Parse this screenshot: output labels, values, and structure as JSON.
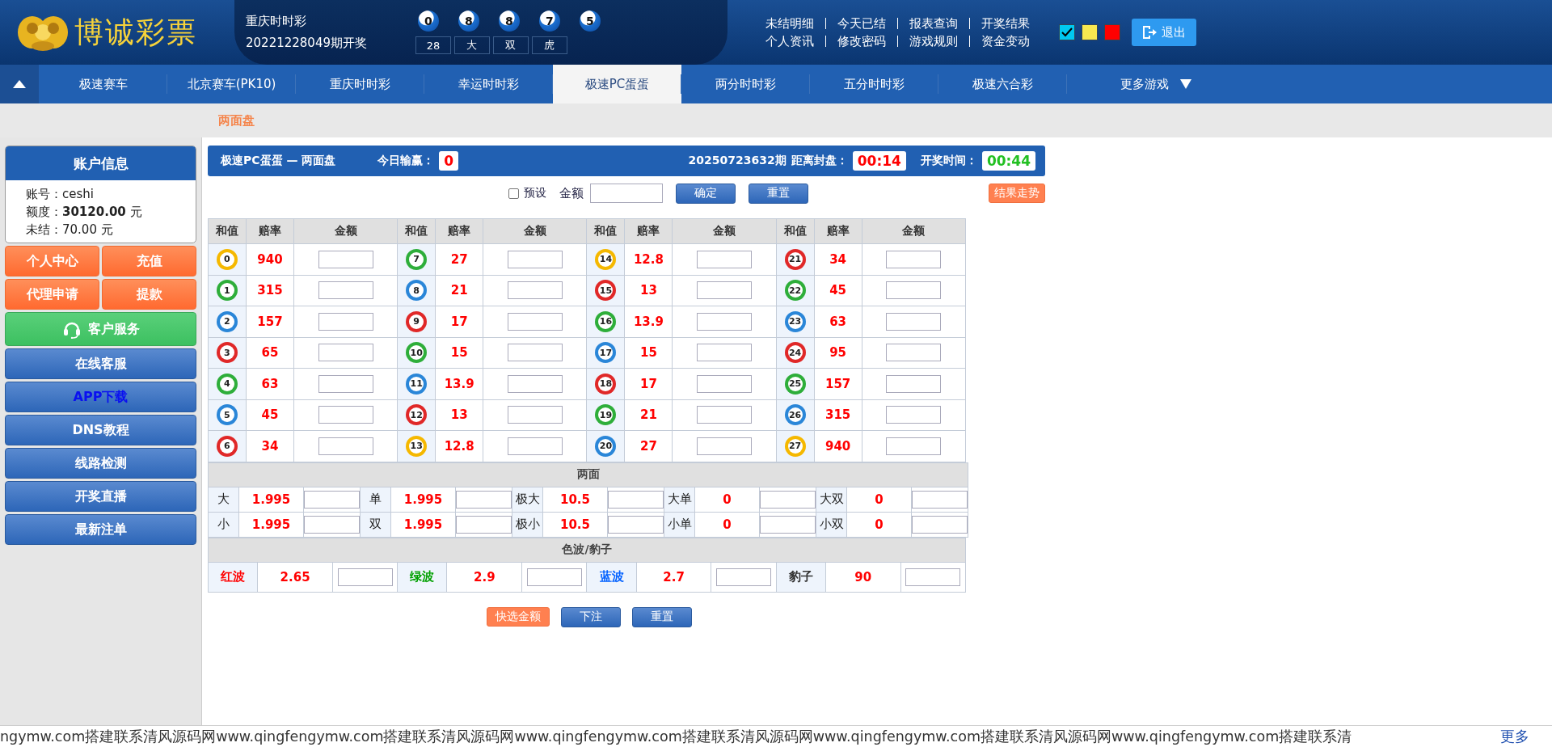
{
  "header": {
    "logo_text": "博诚彩票",
    "lottery": {
      "name": "重庆时时彩",
      "draw": "20221228049期开奖",
      "balls": [
        "0",
        "8",
        "8",
        "7",
        "5"
      ],
      "tags": [
        "28",
        "大",
        "双",
        "虎"
      ]
    },
    "link_rows": [
      [
        "未结明细",
        "今天已结",
        "报表查询",
        "开奖结果"
      ],
      [
        "个人资讯",
        "修改密码",
        "游戏规则",
        "资金变动"
      ]
    ],
    "themes": [
      {
        "color": "#00c8f0",
        "selected": true
      },
      {
        "color": "#f8e850",
        "selected": false
      },
      {
        "color": "#ff0000",
        "selected": false
      }
    ],
    "logout": "退出"
  },
  "nav": {
    "tabs": [
      {
        "label": "极速赛车",
        "selected": false
      },
      {
        "label": "北京赛车(PK10)",
        "selected": false
      },
      {
        "label": "重庆时时彩",
        "selected": false
      },
      {
        "label": "幸运时时彩",
        "selected": false
      },
      {
        "label": "极速PC蛋蛋",
        "selected": true
      },
      {
        "label": "两分时时彩",
        "selected": false
      },
      {
        "label": "五分时时彩",
        "selected": false
      },
      {
        "label": "极速六合彩",
        "selected": false
      }
    ],
    "more": "更多游戏"
  },
  "subnav": "两面盘",
  "sidebar": {
    "account_title": "账户信息",
    "fields": [
      {
        "label": "账号：",
        "value": "ceshi",
        "emphasis": false
      },
      {
        "label": "额度：",
        "value": "30120.00",
        "unit": "元",
        "emphasis": true
      },
      {
        "label": "未结：",
        "value": "70.00",
        "unit": "元",
        "emphasis": false
      }
    ],
    "buttons": [
      {
        "label": "个人中心",
        "kind": "orange"
      },
      {
        "label": "充值",
        "kind": "orange"
      },
      {
        "label": "代理申请",
        "kind": "orange"
      },
      {
        "label": "提款",
        "kind": "orange"
      },
      {
        "label": "客户服务",
        "kind": "service"
      },
      {
        "label": "在线客服",
        "kind": "blue"
      },
      {
        "label": "APP下载",
        "kind": "accent"
      },
      {
        "label": "DNS教程",
        "kind": "blue"
      },
      {
        "label": "线路检测",
        "kind": "blue"
      },
      {
        "label": "开奖直播",
        "kind": "blue"
      },
      {
        "label": "最新注单",
        "kind": "blue"
      }
    ]
  },
  "game_bar": {
    "title": "极速PC蛋蛋 — 两面盘",
    "today_label": "今日输赢：",
    "today_value": "0",
    "period": "20250723632期",
    "close_label": "距离封盘：",
    "close_time": "00:14",
    "draw_label": "开奖时间：",
    "draw_time": "00:44"
  },
  "toolbar": {
    "preset": {
      "label": "预设",
      "checked": false
    },
    "amount_label": "金额",
    "confirm": "确定",
    "reset": "重置",
    "trend": "结果走势"
  },
  "sum_groups": [
    {
      "columns": [
        "和值",
        "赔率",
        "金额"
      ],
      "rows": [
        {
          "number": "0",
          "color": "#f5b800",
          "odds": "940"
        },
        {
          "number": "1",
          "color": "#2eae3a",
          "odds": "315"
        },
        {
          "number": "2",
          "color": "#2a86d8",
          "odds": "157"
        },
        {
          "number": "3",
          "color": "#e02828",
          "odds": "65"
        },
        {
          "number": "4",
          "color": "#2eae3a",
          "odds": "63"
        },
        {
          "number": "5",
          "color": "#2a86d8",
          "odds": "45"
        },
        {
          "number": "6",
          "color": "#e02828",
          "odds": "34"
        }
      ]
    },
    {
      "columns": [
        "和值",
        "赔率",
        "金额"
      ],
      "rows": [
        {
          "number": "7",
          "color": "#2eae3a",
          "odds": "27"
        },
        {
          "number": "8",
          "color": "#2a86d8",
          "odds": "21"
        },
        {
          "number": "9",
          "color": "#e02828",
          "odds": "17"
        },
        {
          "number": "10",
          "color": "#2eae3a",
          "odds": "15"
        },
        {
          "number": "11",
          "color": "#2a86d8",
          "odds": "13.9"
        },
        {
          "number": "12",
          "color": "#e02828",
          "odds": "13"
        },
        {
          "number": "13",
          "color": "#f5b800",
          "odds": "12.8"
        }
      ]
    },
    {
      "columns": [
        "和值",
        "赔率",
        "金额"
      ],
      "rows": [
        {
          "number": "14",
          "color": "#f5b800",
          "odds": "12.8"
        },
        {
          "number": "15",
          "color": "#e02828",
          "odds": "13"
        },
        {
          "number": "16",
          "color": "#2eae3a",
          "odds": "13.9"
        },
        {
          "number": "17",
          "color": "#2a86d8",
          "odds": "15"
        },
        {
          "number": "18",
          "color": "#e02828",
          "odds": "17"
        },
        {
          "number": "19",
          "color": "#2eae3a",
          "odds": "21"
        },
        {
          "number": "20",
          "color": "#2a86d8",
          "odds": "27"
        }
      ]
    },
    {
      "columns": [
        "和值",
        "赔率",
        "金额"
      ],
      "rows": [
        {
          "number": "21",
          "color": "#e02828",
          "odds": "34"
        },
        {
          "number": "22",
          "color": "#2eae3a",
          "odds": "45"
        },
        {
          "number": "23",
          "color": "#2a86d8",
          "odds": "63"
        },
        {
          "number": "24",
          "color": "#e02828",
          "odds": "95"
        },
        {
          "number": "25",
          "color": "#2eae3a",
          "odds": "157"
        },
        {
          "number": "26",
          "color": "#2a86d8",
          "odds": "315"
        },
        {
          "number": "27",
          "color": "#f5b800",
          "odds": "940"
        }
      ]
    }
  ],
  "two_sides": {
    "title": "两面",
    "rows": [
      [
        {
          "label": "大",
          "odds": "1.995"
        },
        {
          "label": "单",
          "odds": "1.995"
        },
        {
          "label": "极大",
          "odds": "10.5"
        },
        {
          "label": "大单",
          "odds": "0"
        },
        {
          "label": "大双",
          "odds": "0"
        }
      ],
      [
        {
          "label": "小",
          "odds": "1.995"
        },
        {
          "label": "双",
          "odds": "1.995"
        },
        {
          "label": "极小",
          "odds": "10.5"
        },
        {
          "label": "小单",
          "odds": "0"
        },
        {
          "label": "小双",
          "odds": "0"
        }
      ]
    ]
  },
  "color_wave": {
    "title": "色波/豹子",
    "items": [
      {
        "label": "红波",
        "color": "#ff0000",
        "odds": "2.65"
      },
      {
        "label": "绿波",
        "color": "#00a000",
        "odds": "2.9"
      },
      {
        "label": "蓝波",
        "color": "#0060ff",
        "odds": "2.7"
      },
      {
        "label": "豹子",
        "color": "#333333",
        "odds": "90"
      }
    ]
  },
  "actions": {
    "quick": "快选金额",
    "submit": "下注",
    "reset": "重置"
  },
  "footer": {
    "marquee": "ngymw.com搭建联系清风源码网www.qingfengymw.com搭建联系清风源码网www.qingfengymw.com搭建联系清风源码网www.qingfengymw.com搭建联系清风源码网www.qingfengymw.com搭建联系清",
    "more": "更多"
  }
}
